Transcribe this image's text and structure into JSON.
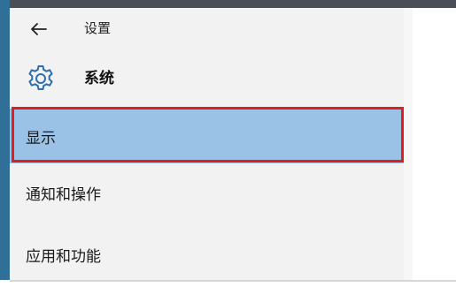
{
  "header": {
    "back_icon": "back-arrow-icon",
    "title": "设置"
  },
  "section": {
    "icon": "gear-icon",
    "title": "系统"
  },
  "nav": {
    "items": [
      {
        "label": "显示",
        "selected": true
      },
      {
        "label": "通知和操作",
        "selected": false
      },
      {
        "label": "应用和功能",
        "selected": false
      }
    ]
  },
  "colors": {
    "selected_background": "#99c2e6",
    "highlight_border": "#e01e1e",
    "accent": "#2f6f98",
    "sidebar_background": "#f2f2f2"
  }
}
